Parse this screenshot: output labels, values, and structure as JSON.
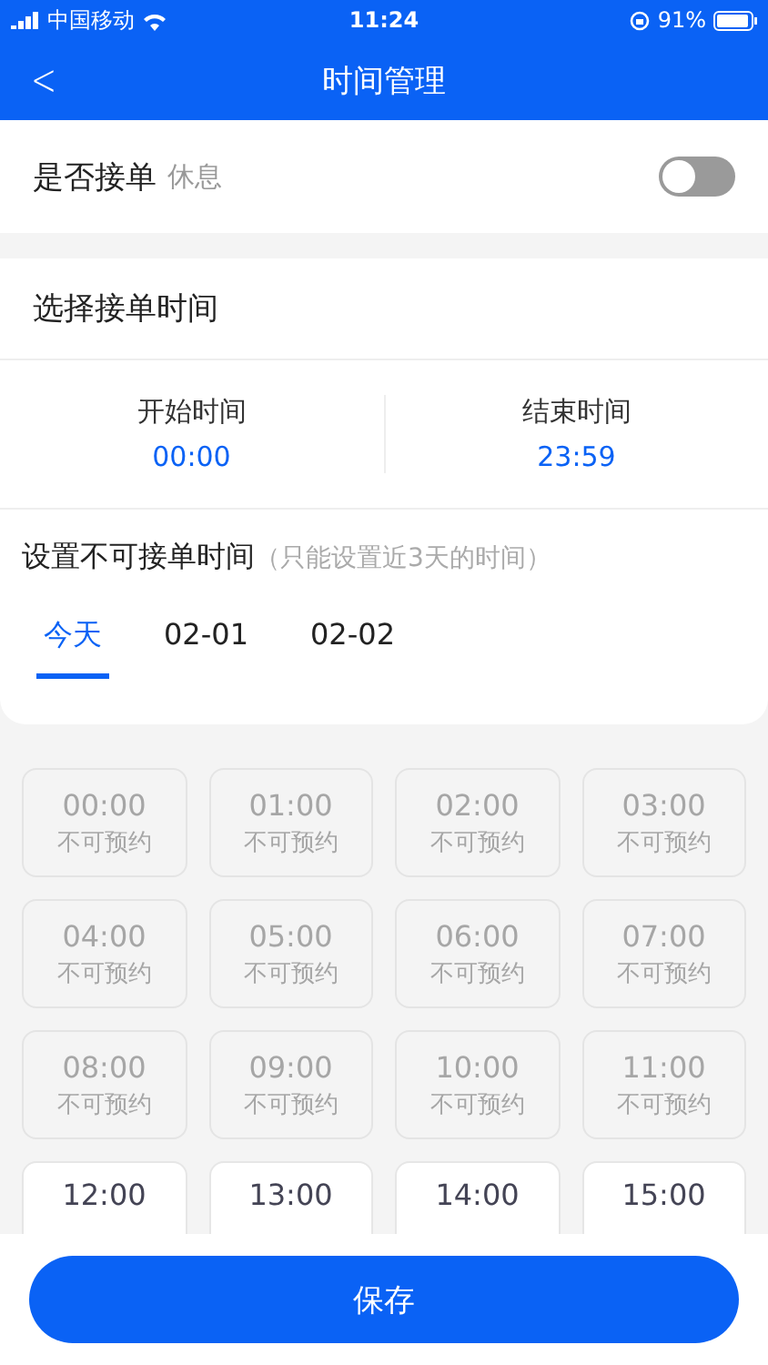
{
  "status_bar": {
    "carrier": "中国移动",
    "time": "11:24",
    "battery": "91%"
  },
  "nav": {
    "back": "<",
    "title": "时间管理"
  },
  "accept_orders": {
    "label": "是否接单",
    "status": "休息",
    "on": false
  },
  "time_range": {
    "title": "选择接单时间",
    "start_label": "开始时间",
    "start": "00:00",
    "end_label": "结束时间",
    "end": "23:59"
  },
  "unavailable": {
    "title": "设置不可接单时间",
    "hint": "（只能设置近3天的时间）"
  },
  "tabs": [
    {
      "label": "今天",
      "selected": true
    },
    {
      "label": "02-01",
      "selected": false
    },
    {
      "label": "02-02",
      "selected": false
    }
  ],
  "slots": [
    {
      "time": "00:00",
      "status": "不可预约",
      "available": false
    },
    {
      "time": "01:00",
      "status": "不可预约",
      "available": false
    },
    {
      "time": "02:00",
      "status": "不可预约",
      "available": false
    },
    {
      "time": "03:00",
      "status": "不可预约",
      "available": false
    },
    {
      "time": "04:00",
      "status": "不可预约",
      "available": false
    },
    {
      "time": "05:00",
      "status": "不可预约",
      "available": false
    },
    {
      "time": "06:00",
      "status": "不可预约",
      "available": false
    },
    {
      "time": "07:00",
      "status": "不可预约",
      "available": false
    },
    {
      "time": "08:00",
      "status": "不可预约",
      "available": false
    },
    {
      "time": "09:00",
      "status": "不可预约",
      "available": false
    },
    {
      "time": "10:00",
      "status": "不可预约",
      "available": false
    },
    {
      "time": "11:00",
      "status": "不可预约",
      "available": false
    },
    {
      "time": "12:00",
      "available": true
    },
    {
      "time": "13:00",
      "available": true
    },
    {
      "time": "14:00",
      "available": true
    },
    {
      "time": "15:00",
      "available": true
    }
  ],
  "save_button": "保存"
}
